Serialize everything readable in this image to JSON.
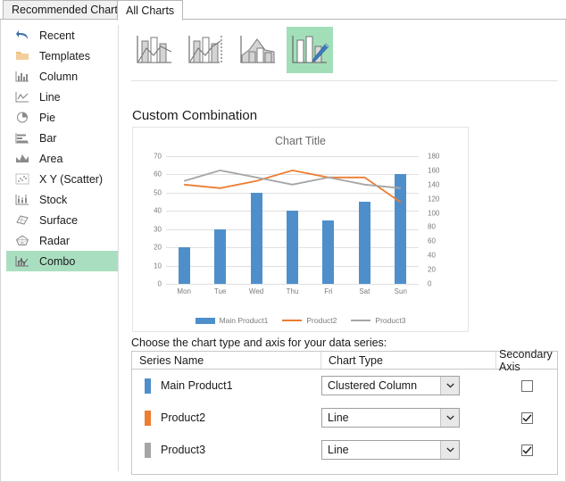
{
  "tabs": [
    {
      "label": "Recommended Charts",
      "active": false
    },
    {
      "label": "All Charts",
      "active": true
    }
  ],
  "sidebar": {
    "items": [
      {
        "label": "Recent",
        "icon": "undo-arrow-icon",
        "selected": false
      },
      {
        "label": "Templates",
        "icon": "folder-icon",
        "selected": false
      },
      {
        "label": "Column",
        "icon": "column-chart-icon",
        "selected": false
      },
      {
        "label": "Line",
        "icon": "line-chart-icon",
        "selected": false
      },
      {
        "label": "Pie",
        "icon": "pie-chart-icon",
        "selected": false
      },
      {
        "label": "Bar",
        "icon": "bar-chart-icon",
        "selected": false
      },
      {
        "label": "Area",
        "icon": "area-chart-icon",
        "selected": false
      },
      {
        "label": "X Y (Scatter)",
        "icon": "scatter-chart-icon",
        "selected": false
      },
      {
        "label": "Stock",
        "icon": "stock-chart-icon",
        "selected": false
      },
      {
        "label": "Surface",
        "icon": "surface-chart-icon",
        "selected": false
      },
      {
        "label": "Radar",
        "icon": "radar-chart-icon",
        "selected": false
      },
      {
        "label": "Combo",
        "icon": "combo-chart-icon",
        "selected": true
      }
    ]
  },
  "thumbnails": [
    {
      "name": "clustered-column-line",
      "selected": false
    },
    {
      "name": "clustered-column-line-secondary-axis",
      "selected": false
    },
    {
      "name": "stacked-area-clustered-column",
      "selected": false
    },
    {
      "name": "custom-combination",
      "selected": true
    }
  ],
  "preview": {
    "heading": "Custom Combination"
  },
  "chart_data": {
    "type": "bar",
    "title": "Chart Title",
    "xlabel": "",
    "ylabel": "",
    "categories": [
      "Mon",
      "Tue",
      "Wed",
      "Thu",
      "Fri",
      "Sat",
      "Sun"
    ],
    "ylim": [
      0,
      70
    ],
    "yticks": [
      0,
      10,
      20,
      30,
      40,
      50,
      60,
      70
    ],
    "y2lim": [
      0,
      180
    ],
    "y2ticks": [
      0,
      20,
      40,
      60,
      80,
      100,
      120,
      140,
      160,
      180
    ],
    "grid": true,
    "legend_position": "bottom",
    "series": [
      {
        "name": "Main Product1",
        "kind": "column",
        "axis": "primary",
        "color": "#4E8FCB",
        "values": [
          20,
          30,
          50,
          40,
          35,
          45,
          60
        ]
      },
      {
        "name": "Product2",
        "kind": "line",
        "axis": "secondary",
        "color": "#ED7D31",
        "values": [
          140,
          135,
          145,
          160,
          150,
          150,
          115
        ]
      },
      {
        "name": "Product3",
        "kind": "line",
        "axis": "secondary",
        "color": "#A5A5A5",
        "values": [
          145,
          160,
          150,
          140,
          150,
          140,
          135
        ]
      }
    ]
  },
  "series_section": {
    "instruction": "Choose the chart type and axis for your data series:",
    "columns": [
      "Series Name",
      "Chart Type",
      "Secondary Axis"
    ],
    "rows": [
      {
        "name": "Main Product1",
        "color": "#4E8FCB",
        "chart_type": "Clustered Column",
        "secondary_axis": false
      },
      {
        "name": "Product2",
        "color": "#ED7D31",
        "chart_type": "Line",
        "secondary_axis": true
      },
      {
        "name": "Product3",
        "color": "#A5A5A5",
        "chart_type": "Line",
        "secondary_axis": true
      }
    ]
  },
  "icons": {
    "dropdown_arrow": "chevron-down-icon",
    "checkmark": "check-icon"
  }
}
